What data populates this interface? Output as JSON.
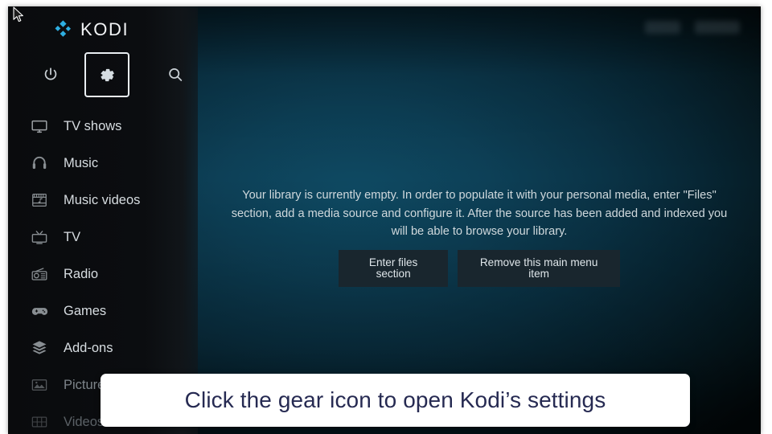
{
  "app": {
    "name": "KODI",
    "logo_icon": "kodi-diamond-logo-icon"
  },
  "topbar": {
    "power_icon": "power-icon",
    "settings_icon": "gear-icon",
    "search_icon": "search-icon",
    "focused_item": "gear-icon"
  },
  "sidebar": {
    "items": [
      {
        "label": "TV shows",
        "icon": "tv-monitor-icon"
      },
      {
        "label": "Music",
        "icon": "headphones-icon"
      },
      {
        "label": "Music videos",
        "icon": "film-music-icon"
      },
      {
        "label": "TV",
        "icon": "retro-tv-icon"
      },
      {
        "label": "Radio",
        "icon": "radio-icon"
      },
      {
        "label": "Games",
        "icon": "gamepad-icon"
      },
      {
        "label": "Add-ons",
        "icon": "addons-box-icon"
      },
      {
        "label": "Pictures",
        "icon": "pictures-icon"
      },
      {
        "label": "Videos",
        "icon": "videos-grid-icon"
      }
    ]
  },
  "main": {
    "empty_message": "Your library is currently empty. In order to populate it with your personal media, enter \"Files\" section, add a media source and configure it. After the source has been added and indexed you will be able to browse your library.",
    "buttons": [
      {
        "label": "Enter files section"
      },
      {
        "label": "Remove this main menu item"
      }
    ]
  },
  "caption": {
    "text": "Click the gear icon to open Kodi’s settings"
  },
  "colors": {
    "accent_logo_blue": "#2eaee0",
    "background_teal": "#0e4a63",
    "sidebar_dark": "#0a0b0d",
    "caption_bg": "#ffffff",
    "caption_text": "#262a52",
    "button_bg": "#19262e",
    "menu_text": "#d7dde1"
  }
}
